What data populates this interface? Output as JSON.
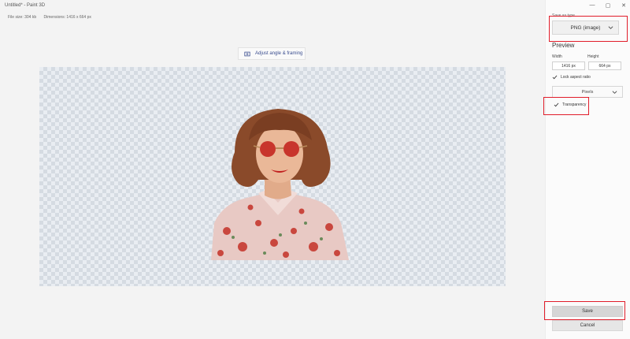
{
  "window": {
    "title": "Untitled* - Paint 3D",
    "file_size": "File size: 304 kb",
    "dimensions": "Dimensions: 1416 x 664 px"
  },
  "toolbar": {
    "adjust_label": "Adjust angle & framing"
  },
  "panel": {
    "save_as_type_label": "Save as type",
    "file_type": "PNG (image)",
    "preview_heading": "Preview",
    "width_label": "Width",
    "height_label": "Height",
    "width_value": "1416 px",
    "height_value": "664 px",
    "lock_aspect_label": "Lock aspect ratio",
    "units": "Pixels",
    "transparency_label": "Transparency",
    "save_label": "Save",
    "cancel_label": "Cancel"
  },
  "window_controls": {
    "minimize": "—",
    "restore": "▢",
    "close": "✕"
  },
  "colors": {
    "highlight": "#e11d2a",
    "accent_text": "#3a4d8f"
  },
  "icons": [
    "crop-icon",
    "chevron-down-icon",
    "check-icon"
  ]
}
